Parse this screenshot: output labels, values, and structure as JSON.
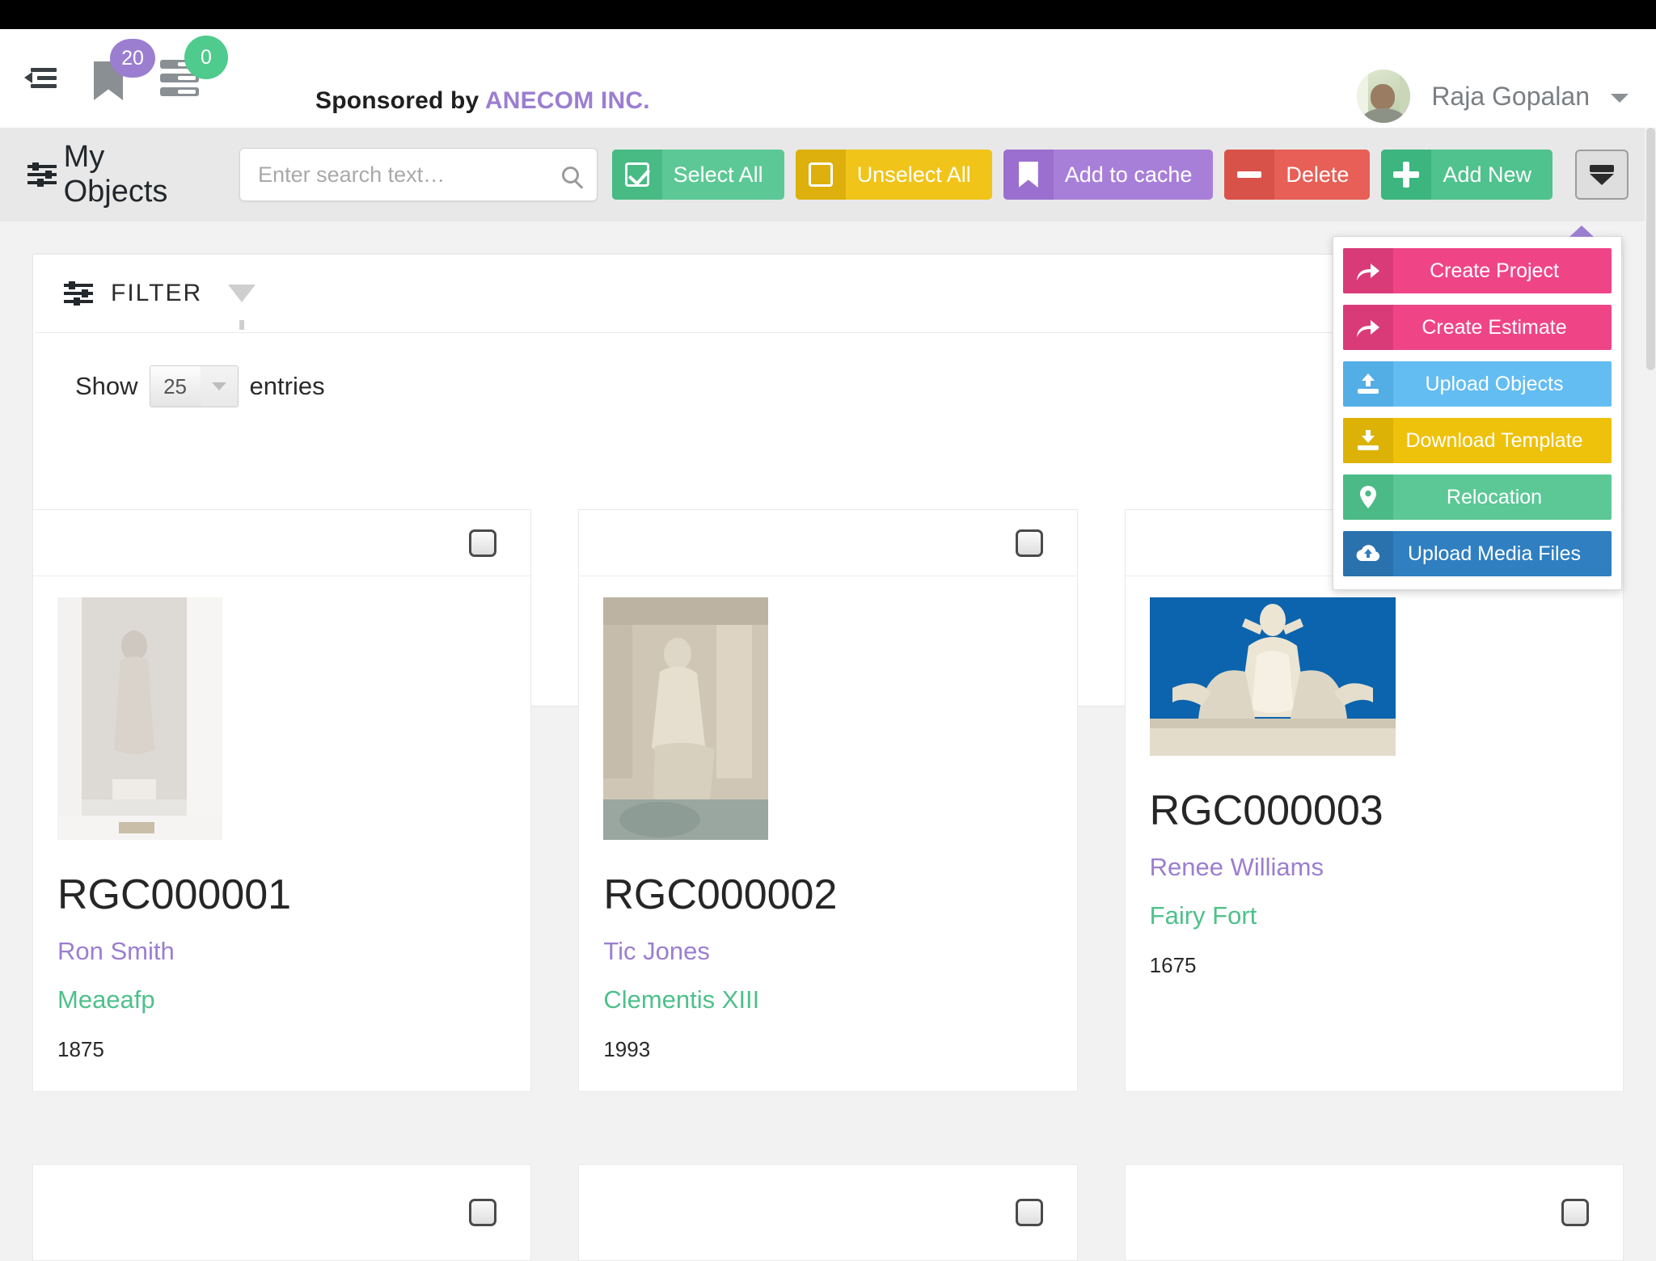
{
  "header": {
    "menu_icon": "hamburger-collapse-icon",
    "bookmark_icon": "bookmark-icon",
    "bookmark_badge": "20",
    "list_icon": "list-icon",
    "list_badge": "0",
    "sponsor_prefix": "Sponsored by ",
    "sponsor_brand": "ANECOM INC.",
    "user_name": "Raja Gopalan",
    "user_caret_icon": "chevron-down-icon",
    "avatar_icon": "avatar"
  },
  "toolbar": {
    "title": "My Objects",
    "title_icon": "sliders-icon",
    "search": {
      "value": "",
      "placeholder": "Enter search text…",
      "icon": "search-icon"
    },
    "buttons": [
      {
        "label": "Select All",
        "icon": "checkbox-checked-icon",
        "bg": "#5cc896",
        "icon_bg": "#48bb84"
      },
      {
        "label": "Unselect All",
        "icon": "checkbox-empty-icon",
        "bg": "#f0c419",
        "icon_bg": "#ddb00d"
      },
      {
        "label": "Add to cache",
        "icon": "bookmark-icon",
        "bg": "#a87fd8",
        "icon_bg": "#9a6fd0"
      },
      {
        "label": "Delete",
        "icon": "minus-icon",
        "bg": "#e75f56",
        "icon_bg": "#d95249"
      },
      {
        "label": "Add New",
        "icon": "plus-icon",
        "bg": "#4fc28d",
        "icon_bg": "#3cb57e"
      }
    ],
    "more_button": {
      "icon": "caret-down-filled-icon",
      "label": ""
    }
  },
  "dropdown": {
    "items": [
      {
        "label": "Create Project",
        "icon": "share-arrow-icon",
        "bg": "#ef4587",
        "icon_bg": "#d93b79"
      },
      {
        "label": "Create Estimate",
        "icon": "share-arrow-icon",
        "bg": "#ef4587",
        "icon_bg": "#d93b79"
      },
      {
        "label": "Upload Objects",
        "icon": "upload-icon",
        "bg": "#63bdf2",
        "icon_bg": "#53aee5"
      },
      {
        "label": "Download Template",
        "icon": "download-icon",
        "bg": "#eec10b",
        "icon_bg": "#dcb207"
      },
      {
        "label": "Relocation",
        "icon": "map-pin-icon",
        "bg": "#5cc896",
        "icon_bg": "#4bba86"
      },
      {
        "label": "Upload Media Files",
        "icon": "cloud-upload-icon",
        "bg": "#2f7fc1",
        "icon_bg": "#2a72ae"
      }
    ]
  },
  "filter": {
    "label": "FILTER",
    "icon": "sliders-icon",
    "funnel_icon": "funnel-icon"
  },
  "entries": {
    "prefix": "Show",
    "value": "25",
    "suffix": "entries",
    "caret_icon": "chevron-down-icon"
  },
  "cards": [
    {
      "id": "RGC000001",
      "owner": "Ron Smith",
      "name": "Meaeafp",
      "year": "1875",
      "thumb": "statue-in-niche",
      "checkbox_icon": "checkbox-icon"
    },
    {
      "id": "RGC000002",
      "owner": "Tic Jones",
      "name": "Clementis XIII",
      "year": "1993",
      "thumb": "trevi-statue",
      "checkbox_icon": "checkbox-icon"
    },
    {
      "id": "RGC000003",
      "owner": "Renee Williams",
      "name": "Fairy Fort",
      "year": "1675",
      "thumb": "coat-of-arms",
      "checkbox_icon": "checkbox-icon"
    }
  ],
  "cards_next_row": [
    {
      "checkbox_icon": "checkbox-icon"
    },
    {
      "checkbox_icon": "checkbox-icon"
    },
    {
      "checkbox_icon": "checkbox-icon"
    }
  ]
}
